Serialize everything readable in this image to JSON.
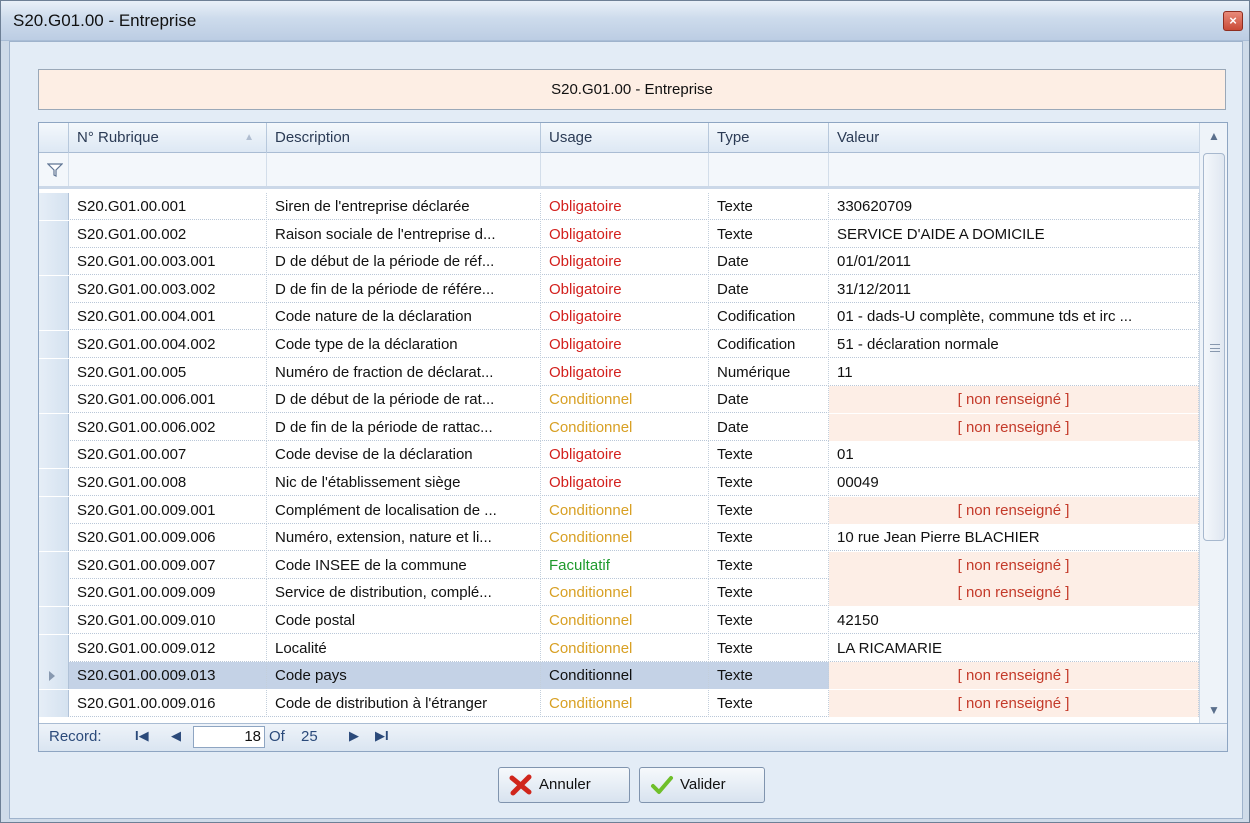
{
  "window": {
    "title": "S20.G01.00 - Entreprise"
  },
  "header_panel": {
    "text": "S20.G01.00 - Entreprise"
  },
  "grid": {
    "columns": [
      "N° Rubrique",
      "Description",
      "Usage",
      "Type",
      "Valeur"
    ],
    "rows": [
      {
        "rub": "S20.G01.00.001",
        "desc": "Siren de l'entreprise déclarée",
        "usage": "Obligatoire",
        "type": "Texte",
        "val": "330620709"
      },
      {
        "rub": "S20.G01.00.002",
        "desc": "Raison sociale de l'entreprise d...",
        "usage": "Obligatoire",
        "type": "Texte",
        "val": "SERVICE D'AIDE A DOMICILE"
      },
      {
        "rub": "S20.G01.00.003.001",
        "desc": "D de début de la période de réf...",
        "usage": "Obligatoire",
        "type": "Date",
        "val": "01/01/2011"
      },
      {
        "rub": "S20.G01.00.003.002",
        "desc": "D de fin de la période de référe...",
        "usage": "Obligatoire",
        "type": "Date",
        "val": "31/12/2011"
      },
      {
        "rub": "S20.G01.00.004.001",
        "desc": "Code nature de la déclaration",
        "usage": "Obligatoire",
        "type": "Codification",
        "val": "01 - dads-U complète, commune tds et irc ..."
      },
      {
        "rub": "S20.G01.00.004.002",
        "desc": "Code type de la déclaration",
        "usage": "Obligatoire",
        "type": "Codification",
        "val": "51 - déclaration normale"
      },
      {
        "rub": "S20.G01.00.005",
        "desc": "Numéro de fraction de déclarat...",
        "usage": "Obligatoire",
        "type": "Numérique",
        "val": "11"
      },
      {
        "rub": "S20.G01.00.006.001",
        "desc": "D de début de la période de rat...",
        "usage": "Conditionnel",
        "type": "Date",
        "val": "[ non renseigné ]"
      },
      {
        "rub": "S20.G01.00.006.002",
        "desc": "D de fin de la période de rattac...",
        "usage": "Conditionnel",
        "type": "Date",
        "val": "[ non renseigné ]"
      },
      {
        "rub": "S20.G01.00.007",
        "desc": "Code devise de la déclaration",
        "usage": "Obligatoire",
        "type": "Texte",
        "val": "01"
      },
      {
        "rub": "S20.G01.00.008",
        "desc": "Nic de l'établissement siège",
        "usage": "Obligatoire",
        "type": "Texte",
        "val": "00049"
      },
      {
        "rub": "S20.G01.00.009.001",
        "desc": "Complément de localisation de ...",
        "usage": "Conditionnel",
        "type": "Texte",
        "val": "[ non renseigné ]"
      },
      {
        "rub": "S20.G01.00.009.006",
        "desc": "Numéro, extension, nature et li...",
        "usage": "Conditionnel",
        "type": "Texte",
        "val": "10 rue Jean Pierre BLACHIER"
      },
      {
        "rub": "S20.G01.00.009.007",
        "desc": "Code INSEE de la commune",
        "usage": "Facultatif",
        "type": "Texte",
        "val": "[ non renseigné ]"
      },
      {
        "rub": "S20.G01.00.009.009",
        "desc": "Service de distribution, complé...",
        "usage": "Conditionnel",
        "type": "Texte",
        "val": "[ non renseigné ]"
      },
      {
        "rub": "S20.G01.00.009.010",
        "desc": "Code postal",
        "usage": "Conditionnel",
        "type": "Texte",
        "val": "42150"
      },
      {
        "rub": "S20.G01.00.009.012",
        "desc": "Localité",
        "usage": "Conditionnel",
        "type": "Texte",
        "val": "LA RICAMARIE"
      },
      {
        "rub": "S20.G01.00.009.013",
        "desc": "Code pays",
        "usage": "Conditionnel",
        "type": "Texte",
        "val": "[ non renseigné ]",
        "selected": true
      },
      {
        "rub": "S20.G01.00.009.016",
        "desc": "Code de distribution à l'étranger",
        "usage": "Conditionnel",
        "type": "Texte",
        "val": "[ non renseigné ]"
      }
    ]
  },
  "navigator": {
    "label": "Record:",
    "current": "18",
    "of_label": "Of",
    "total": "25"
  },
  "buttons": {
    "cancel": "Annuler",
    "validate": "Valider"
  },
  "colors": {
    "obligatoire": "#d3201d",
    "conditionnel": "#d8a024",
    "facultatif": "#1e9a2c"
  }
}
